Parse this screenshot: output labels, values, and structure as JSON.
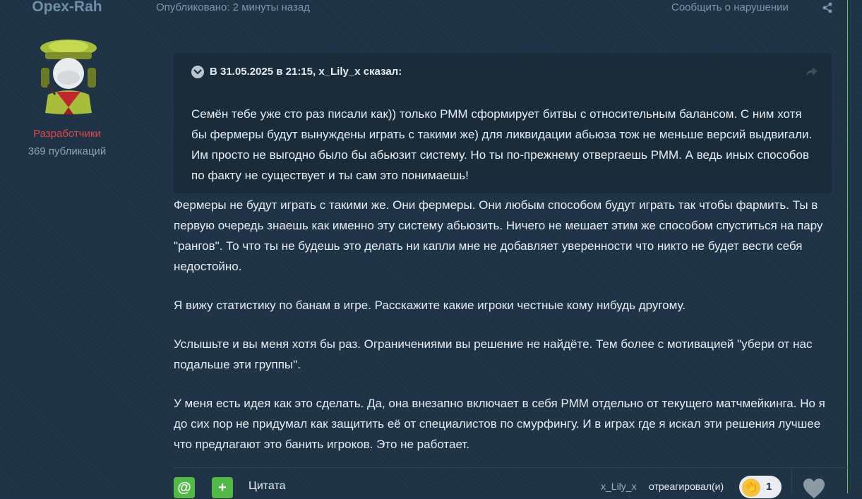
{
  "author": {
    "name": "Opex-Rah",
    "role": "Разработчики",
    "posts": "369 публикаций"
  },
  "post": {
    "published": "Опубликовано: 2 минуты назад",
    "report": "Сообщить о нарушении",
    "quote": {
      "cite": "В 31.05.2025 в 21:15, x_Lily_x сказал:",
      "text": "Семён тебе уже сто раз писали как)) только РММ сформирует битвы с относительным балансом. С ним хотя бы фермеры будут вынуждены играть с такими же) для ликвидации абьюза тож не меньше версий выдвигали. Им просто не выгодно было бы абьюзит систему. Но ты по-прежнему отвергаешь РММ. А ведь иных способов по факту не существует и ты сам это понимаешь!"
    },
    "paragraphs": [
      "Фермеры не будут играть с такими же. Они фермеры. Они любым способом будут играть так чтобы фармить. Ты в первую очередь знаешь как именно эту систему абьюзить. Ничего не мешает этим же способом спуститься на пару \"рангов\". То что ты не будешь это делать ни капли мне не добавляет уверенности что никто не будет вести себя недостойно.",
      "Я вижу статистику по банам в игре. Расскажите какие игроки честные кому нибудь другому.",
      "Услышьте и вы меня хотя бы раз. Ограничениями вы решение не найдёте. Тем более с мотивацией \"убери от нас подальше эти группы\".",
      "У меня есть идея как это сделать. Да, она внезапно включает в себя РММ отдельно от текущего матчмейкинга. Но я до сих пор не придумал как защитить её от специалистов по смурфингу. И в играх где я искал эти решения лучшее что предлагают это банить игроков. Это не работает."
    ]
  },
  "footer": {
    "mention_label": "@",
    "multiquote_label": "+",
    "quote_label": "Цитата",
    "reactor": "x_Lily_x",
    "reacted_text": "отреагировал(и)",
    "reaction_count": "1"
  },
  "colors": {
    "background": "#1e3345",
    "accent_green": "#52b947",
    "role_red": "#e04646"
  },
  "icons": {
    "share": "share-icon",
    "quote_toggle": "chevron-down-icon",
    "quote_forward": "forward-arrow-icon",
    "reaction": "clap-emoji-icon",
    "like": "heart-icon"
  }
}
